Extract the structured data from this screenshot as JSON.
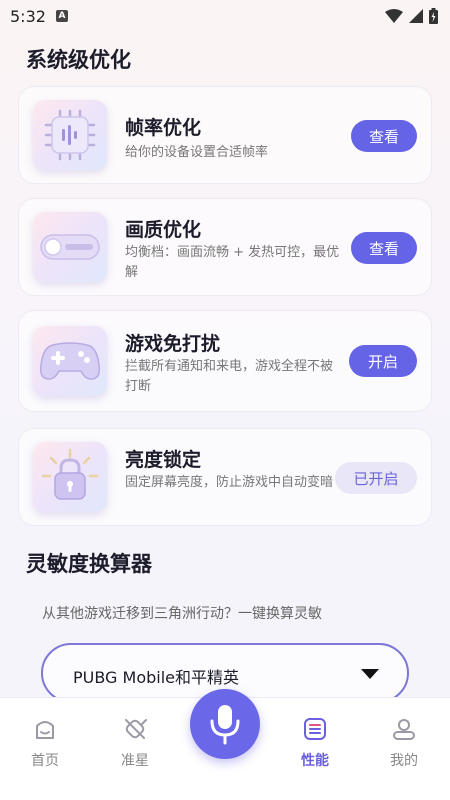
{
  "status_bar": {
    "time": "5:32",
    "notif_icon": "A"
  },
  "section1": {
    "title": "系统级优化"
  },
  "cards": [
    {
      "title": "帧率优化",
      "desc": "给你的设备设置合适帧率",
      "button": "查看",
      "icon": "chip-icon"
    },
    {
      "title": "画质优化",
      "desc": "均衡档：画面流畅 + 发热可控，最优解",
      "button": "查看",
      "icon": "toggle-icon"
    },
    {
      "title": "游戏免打扰",
      "desc": "拦截所有通知和来电，游戏全程不被打断",
      "button": "开启",
      "icon": "gamepad-icon"
    },
    {
      "title": "亮度锁定",
      "desc": "固定屏幕亮度，防止游戏中自动变暗",
      "button": "已开启",
      "icon": "brightness-lock-icon"
    }
  ],
  "section2": {
    "title": "灵敏度换算器",
    "subtitle": "从其他游戏迁移到三角洲行动？一键换算灵敏",
    "dropdown_value": "PUBG Mobile和平精英"
  },
  "nav": [
    {
      "label": "首页",
      "icon": "home-icon"
    },
    {
      "label": "准星",
      "icon": "crosshair-icon"
    },
    {
      "label": "性能",
      "icon": "performance-icon",
      "active": true
    },
    {
      "label": "我的",
      "icon": "profile-icon"
    }
  ],
  "colors": {
    "accent": "#6563e6",
    "enabled_bg": "#e9e6f7",
    "active_nav": "#6a60e0"
  }
}
